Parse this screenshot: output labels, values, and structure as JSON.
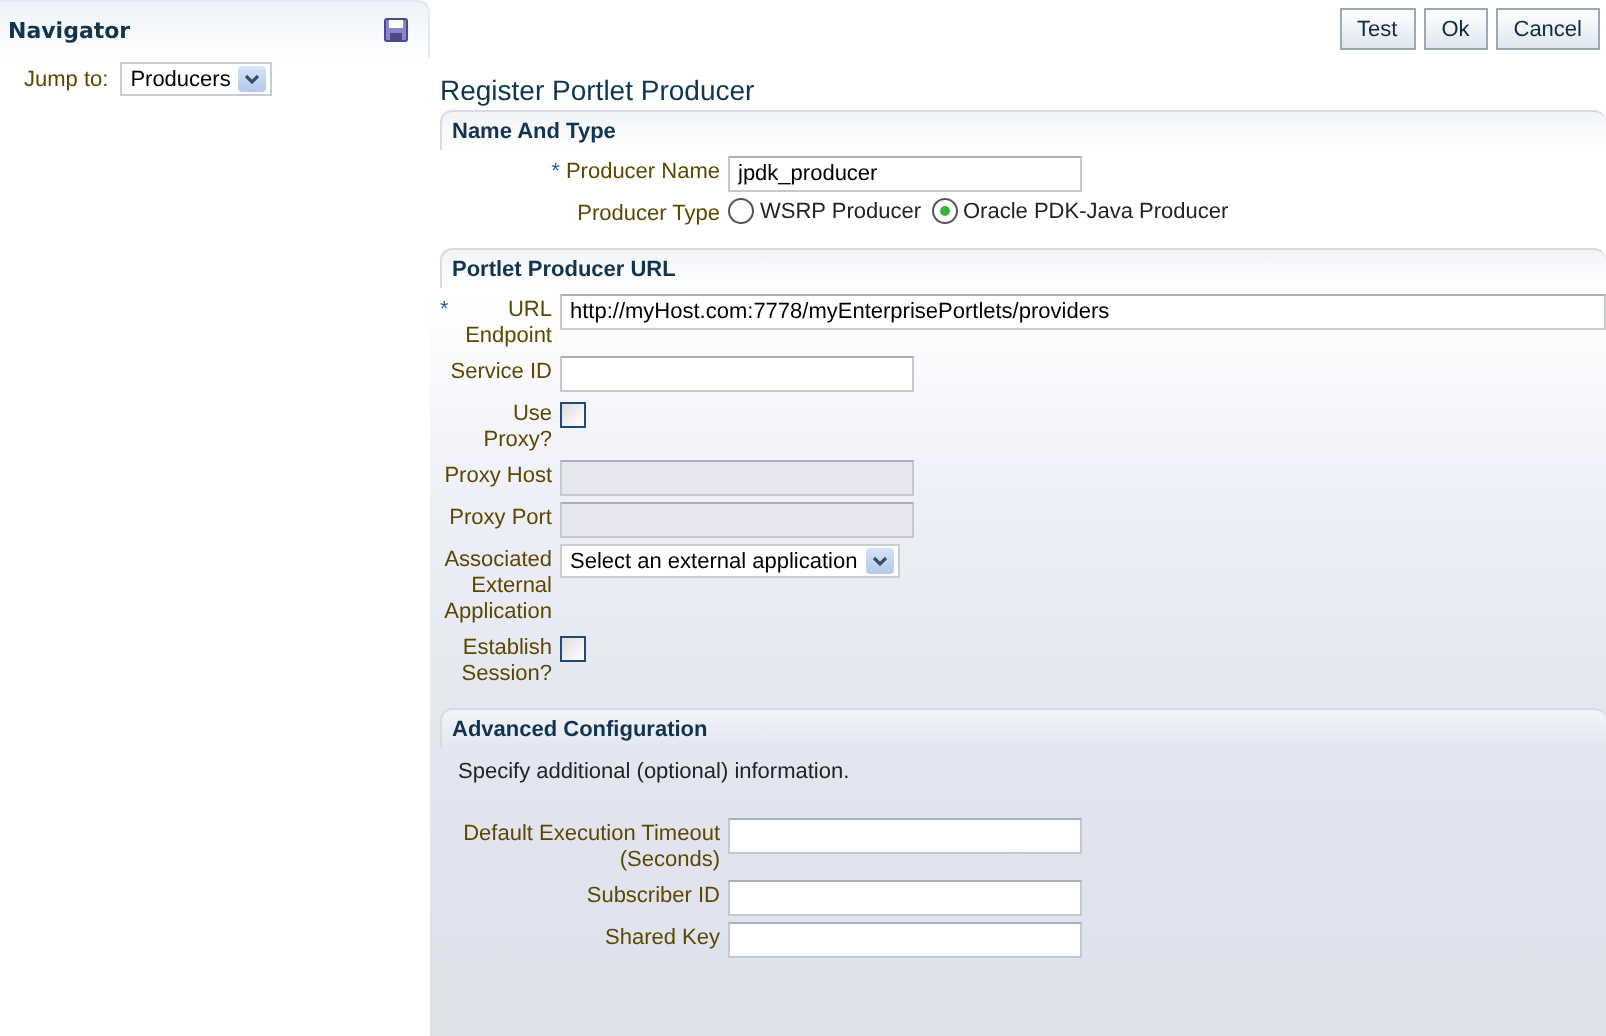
{
  "navigator": {
    "title": "Navigator",
    "jump_label": "Jump to:",
    "jump_value": "Producers"
  },
  "buttons": [
    "Test",
    "Ok",
    "Cancel"
  ],
  "page_title": "Register Portlet Producer",
  "sections": [
    {
      "title": "Name And Type",
      "fields": [
        {
          "kind": "text",
          "required_mark": "*",
          "label": "Producer Name",
          "value": "jpdk_producer",
          "disabled": false
        },
        {
          "kind": "radio",
          "label": "Producer Type",
          "options": [
            {
              "label": "WSRP Producer",
              "selected": false
            },
            {
              "label": "Oracle PDK-Java Producer",
              "selected": true
            }
          ]
        }
      ]
    },
    {
      "title": "Portlet Producer URL",
      "fields": [
        {
          "kind": "widetext",
          "required_mark": "*",
          "label": "URL Endpoint",
          "value": "http://myHost.com:7778/myEnterprisePortlets/providers",
          "disabled": false
        },
        {
          "kind": "text",
          "label": "Service ID",
          "disabled": false
        },
        {
          "kind": "checkbox",
          "label": "Use Proxy?",
          "checked": false
        },
        {
          "kind": "text",
          "label": "Proxy Host",
          "disabled": true
        },
        {
          "kind": "text",
          "label": "Proxy Port",
          "disabled": true
        },
        {
          "kind": "select",
          "label": "Associated External Application",
          "value": "Select an external application"
        },
        {
          "kind": "checkbox",
          "label": "Establish Session?",
          "checked": false
        }
      ]
    },
    {
      "title": "Advanced Configuration",
      "description": "Specify additional (optional) information.",
      "fields": [
        {
          "kind": "text",
          "label": "Default Execution Timeout (Seconds)",
          "disabled": false
        },
        {
          "kind": "text",
          "label": "Subscriber ID",
          "disabled": false
        },
        {
          "kind": "text",
          "label": "Shared Key",
          "disabled": false
        }
      ]
    }
  ]
}
